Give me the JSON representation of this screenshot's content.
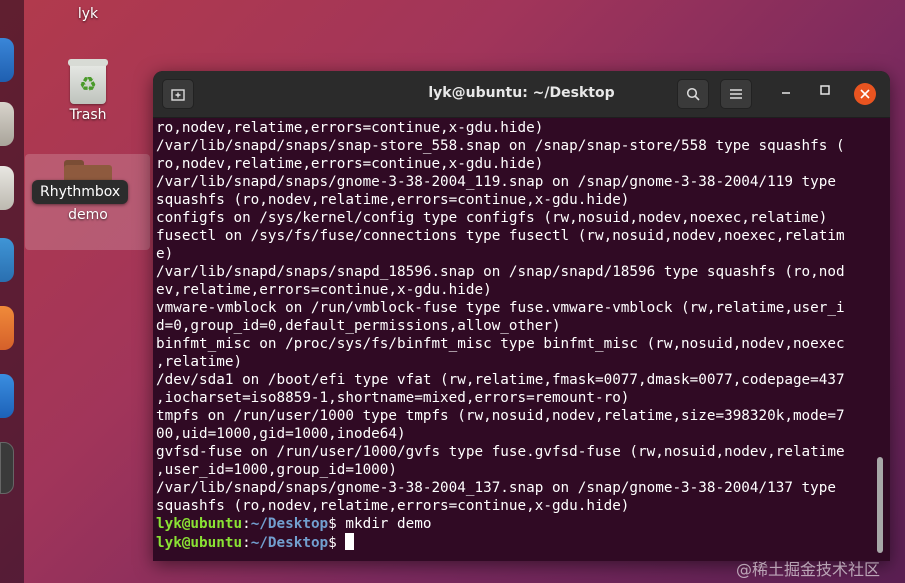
{
  "desktop": {
    "home_label": "lyk",
    "trash_label": "Trash",
    "demo_label": "demo",
    "tooltip": "Rhythmbox"
  },
  "terminal": {
    "title": "lyk@ubuntu: ~/Desktop",
    "icons": {
      "new_tab": "new-tab-icon",
      "search": "search-icon",
      "menu": "hamburger-menu-icon"
    },
    "lines": [
      "ro,nodev,relatime,errors=continue,x-gdu.hide)",
      "/var/lib/snapd/snaps/snap-store_558.snap on /snap/snap-store/558 type squashfs (",
      "ro,nodev,relatime,errors=continue,x-gdu.hide)",
      "/var/lib/snapd/snaps/gnome-3-38-2004_119.snap on /snap/gnome-3-38-2004/119 type",
      "squashfs (ro,nodev,relatime,errors=continue,x-gdu.hide)",
      "configfs on /sys/kernel/config type configfs (rw,nosuid,nodev,noexec,relatime)",
      "fusectl on /sys/fs/fuse/connections type fusectl (rw,nosuid,nodev,noexec,relatim",
      "e)",
      "/var/lib/snapd/snaps/snapd_18596.snap on /snap/snapd/18596 type squashfs (ro,nod",
      "ev,relatime,errors=continue,x-gdu.hide)",
      "vmware-vmblock on /run/vmblock-fuse type fuse.vmware-vmblock (rw,relatime,user_i",
      "d=0,group_id=0,default_permissions,allow_other)",
      "binfmt_misc on /proc/sys/fs/binfmt_misc type binfmt_misc (rw,nosuid,nodev,noexec",
      ",relatime)",
      "/dev/sda1 on /boot/efi type vfat (rw,relatime,fmask=0077,dmask=0077,codepage=437",
      ",iocharset=iso8859-1,shortname=mixed,errors=remount-ro)",
      "tmpfs on /run/user/1000 type tmpfs (rw,nosuid,nodev,relatime,size=398320k,mode=7",
      "00,uid=1000,gid=1000,inode64)",
      "gvfsd-fuse on /run/user/1000/gvfs type fuse.gvfsd-fuse (rw,nosuid,nodev,relatime",
      ",user_id=1000,group_id=1000)",
      "/var/lib/snapd/snaps/gnome-3-38-2004_137.snap on /snap/gnome-3-38-2004/137 type",
      "squashfs (ro,nodev,relatime,errors=continue,x-gdu.hide)"
    ],
    "prompt1": {
      "user": "lyk@ubuntu",
      "sep": ":",
      "path": "~/Desktop",
      "symbol": "$",
      "command": " mkdir demo"
    },
    "prompt2": {
      "user": "lyk@ubuntu",
      "sep": ":",
      "path": "~/Desktop",
      "symbol": "$"
    }
  },
  "watermark": "@稀土掘金技术社区",
  "colors": {
    "terminal_bg": "#300a24",
    "prompt_user": "#8ae234",
    "prompt_path": "#729fcf",
    "close": "#e95420"
  }
}
